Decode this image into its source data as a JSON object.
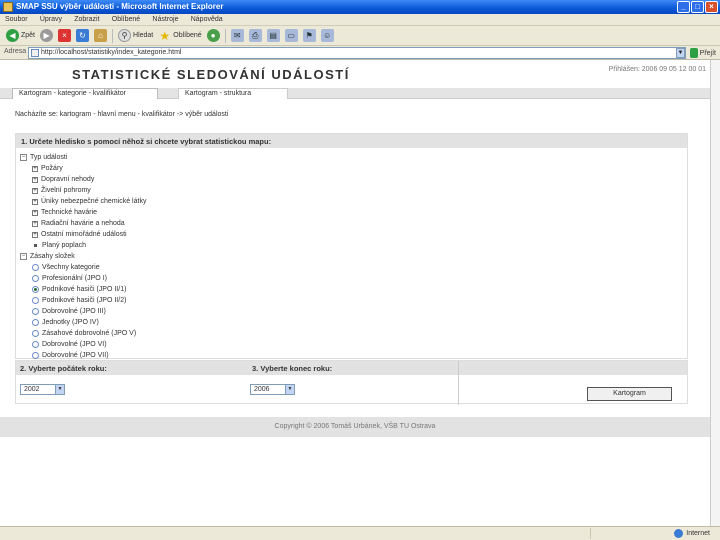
{
  "window": {
    "title": "SMAP SSU výběr události - Microsoft Internet Explorer",
    "minimize": "_",
    "maximize": "□",
    "close": "×"
  },
  "menu": [
    "Soubor",
    "Úpravy",
    "Zobrazit",
    "Oblíbené",
    "Nástroje",
    "Nápověda"
  ],
  "toolbar": {
    "back_label": "Zpět",
    "search_label": "Hledat",
    "favorites_label": "Oblíbené"
  },
  "address": {
    "label": "Adresa",
    "url": "http://localhost/statistiky/index_kategorie.html",
    "go_label": "Přejít"
  },
  "page": {
    "title": "STATISTICKÉ SLEDOVÁNÍ UDÁLOSTÍ",
    "user_info": "Přihlášen: 2006 09 05 12 00 01",
    "tabs": [
      "Kartogram - kategorie - kvalifikátor",
      "Kartogram - struktura"
    ],
    "breadcrumb": "Nacházíte se: kartogram - hlavní menu - kvalifikátor -> výběr události",
    "panel_title": "1. Určete hledisko s pomocí něhož si chcete vybrat statistickou mapu:",
    "tree": {
      "group1": "Typ události",
      "group1_items": [
        "Požáry",
        "Dopravní nehody",
        "Živelní pohromy",
        "Úniky nebezpečné chemické látky",
        "Technické havárie",
        "Radiační havárie a nehoda",
        "Ostatní mimořádné události",
        "Planý poplach"
      ],
      "group2": "Zásahy složek",
      "group2_items": [
        "Všechny kategorie",
        "Profesionální (JPO I)",
        "Podnikové hasiči (JPO II/1)",
        "Podnikové hasiči (JPO II/2)",
        "Dobrovolné (JPO III)",
        "Jednotky (JPO IV)",
        "Zásahové dobrovolné (JPO V)",
        "Dobrovolné (JPO VI)",
        "Dobrovolné (JPO VII)"
      ],
      "group2_selected": 2
    },
    "col1_title": "2. Vyberte počátek roku:",
    "col2_title": "3. Vyberte konec roku:",
    "start_year": "2002",
    "end_year": "2006",
    "action_button": "Kartogram",
    "footer": "Copyright © 2006 Tomáš Urbánek, VŠB TU Ostrava"
  },
  "status": {
    "zone": "Internet"
  }
}
